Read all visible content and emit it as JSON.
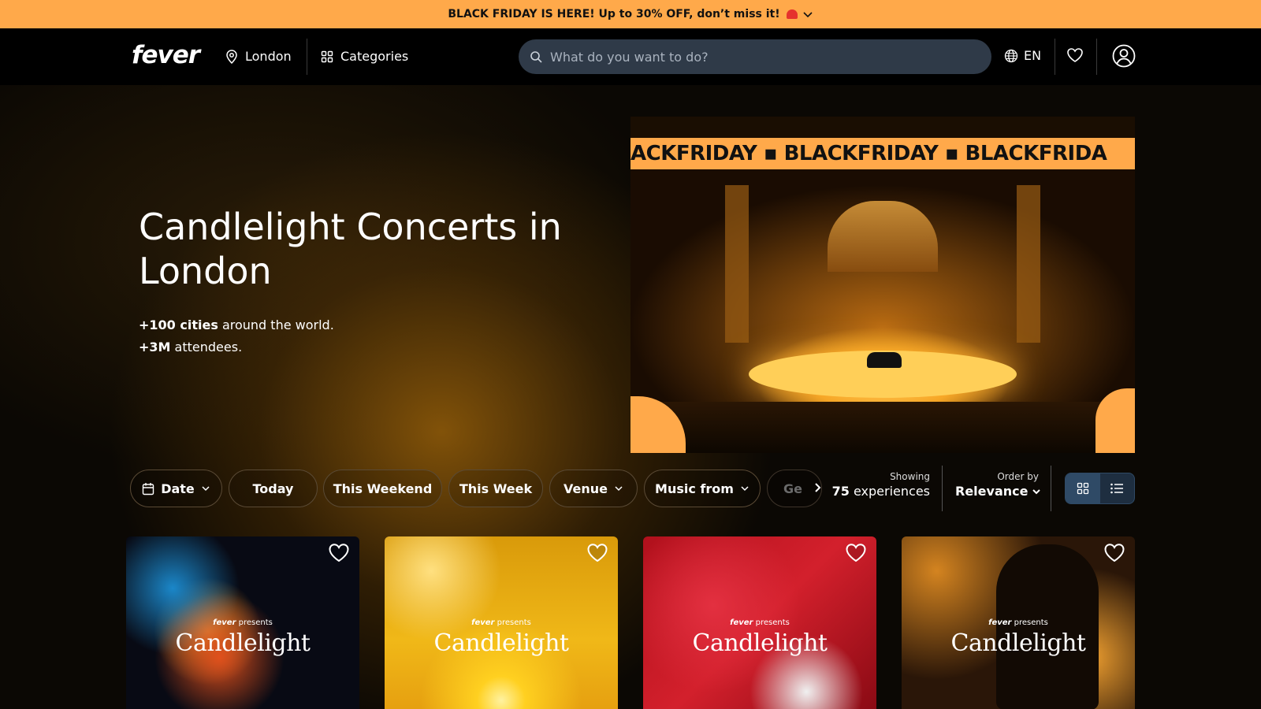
{
  "promo": {
    "text": "BLACK FRIDAY IS HERE! Up to 30% OFF, don’t miss it!"
  },
  "header": {
    "logo": "fever",
    "location": "London",
    "categories": "Categories",
    "search_placeholder": "What do you want to do?",
    "language": "EN"
  },
  "hero": {
    "title": "Candlelight Concerts in London",
    "stat1_bold": "+100 cities",
    "stat1_rest": " around the world.",
    "stat2_bold": "+3M",
    "stat2_rest": " attendees.",
    "banner_text": "ACKFRIDAY  ▪  BLACKFRIDAY  ▪  BLACKFRIDA"
  },
  "filters": {
    "date": "Date",
    "today": "Today",
    "this_weekend": "This Weekend",
    "this_week": "This Week",
    "venue": "Venue",
    "music_from": "Music from",
    "more": "Ge"
  },
  "results": {
    "showing_label": "Showing",
    "count": "75",
    "count_unit": " experiences",
    "order_label": "Order by",
    "order_value": "Relevance"
  },
  "cards": [
    {
      "presents_brand": "fever",
      "presents_text": "presents",
      "title": "Candlelight"
    },
    {
      "presents_brand": "fever",
      "presents_text": "presents",
      "title": "Candlelight"
    },
    {
      "presents_brand": "fever",
      "presents_text": "presents",
      "title": "Candlelight"
    },
    {
      "presents_brand": "fever",
      "presents_text": "presents",
      "title": "Candlelight"
    }
  ],
  "colors": {
    "accent": "#ffa94a",
    "search_bg": "#2f3a48",
    "view_toggle_active": "#2f4a66"
  },
  "icons": [
    "siren-icon",
    "chevron-down-icon",
    "location-pin-icon",
    "grid-icon",
    "search-icon",
    "globe-icon",
    "heart-icon",
    "user-icon",
    "calendar-icon",
    "chevron-right-icon",
    "list-icon"
  ]
}
